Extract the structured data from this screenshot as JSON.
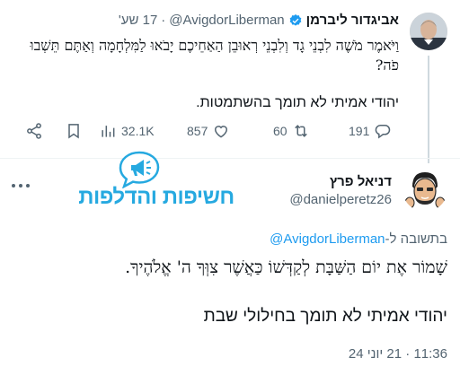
{
  "tweet1": {
    "author_name": "אביגדור ליברמן",
    "handle": "@AvigdorLiberman",
    "separator": "·",
    "time": "17 שע'",
    "verified_color": "#1d9bf0",
    "body_line1": "וַיֹּאמֶר מֹשֶׁה לִבְנֵי גָד וְלִבְנֵי רְאוּבֵן הַאַחֵיכֶם יָבֹאוּ לַמִּלְחָמָה וְאַתֶּם תֵּשְׁבוּ פֹה?",
    "body_line2": "יהודי אמיתי לא תומך בהשתמטות.",
    "actions": {
      "reply_count": "191",
      "retweet_count": "60",
      "like_count": "857",
      "views_count": "32.1K"
    }
  },
  "tweet2": {
    "author_name": "דניאל פרץ",
    "handle": "@danielperetz26",
    "reply_prefix": "בתשובה ל-",
    "reply_link": "@AvigdorLiberman",
    "body_line1": "שָׁמוֹר אֶת יוֹם הַשַּׁבָּת לְקַדְּשׁוֹ כַּאֲשֶׁר צִוְּךָ ה' אֱלֹהֶיךָ.",
    "body_line2": "יהודי אמיתי לא תומך בחילולי שבת",
    "timestamp": "11:36 · 21 יוני 24"
  },
  "watermark": {
    "text": "חשיפות והדלפות",
    "color": "#26a9e0"
  },
  "colors": {
    "link": "#1d9bf0",
    "muted": "#536471",
    "divider": "#eff3f4"
  }
}
